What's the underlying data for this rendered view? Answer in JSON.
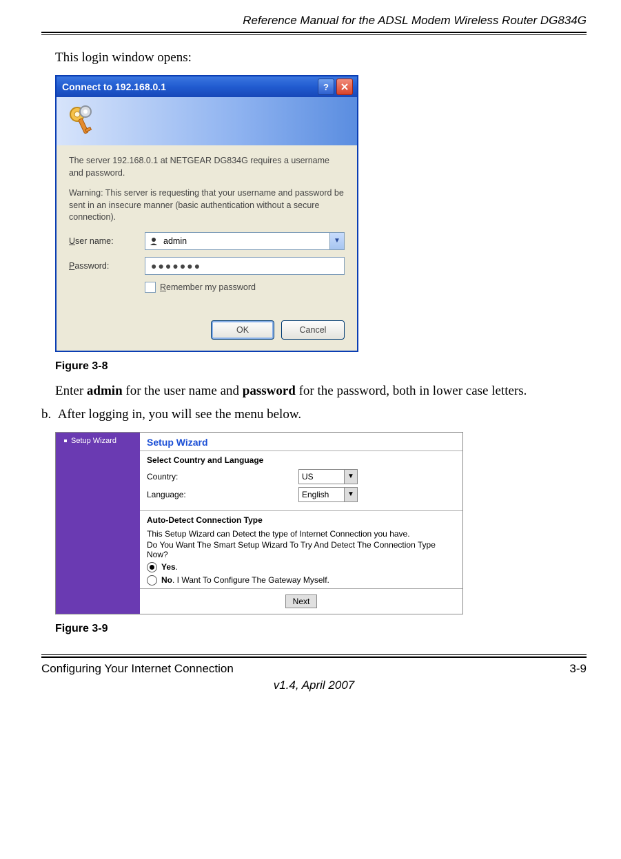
{
  "header": "Reference Manual for the ADSL Modem Wireless Router DG834G",
  "intro": "This login window opens:",
  "dialog": {
    "title": "Connect to 192.168.0.1",
    "msg1": "The server 192.168.0.1 at NETGEAR DG834G  requires a username and password.",
    "msg2": "Warning: This server is requesting that your username and password be sent in an insecure manner (basic authentication without a secure connection).",
    "user_label_u": "U",
    "user_label_rest": "ser name:",
    "user_value": "admin",
    "pass_label_u": "P",
    "pass_label_rest": "assword:",
    "pass_value": "●●●●●●●",
    "remember_u": "R",
    "remember_rest": "emember my password",
    "ok": "OK",
    "cancel": "Cancel"
  },
  "figure8": "Figure 3-8",
  "credentials": {
    "pre": "Enter ",
    "admin": "admin",
    "mid": " for the user name and ",
    "password": "password",
    "post": " for the password, both in lower case letters."
  },
  "step_b_marker": "b.",
  "step_b": "After logging in, you will see the menu below.",
  "wizard": {
    "side": "Setup Wizard",
    "title": "Setup Wizard",
    "section1_h": "Select Country and Language",
    "country_lbl": "Country:",
    "country_val": "US",
    "language_lbl": "Language:",
    "language_val": "English",
    "section2_h": "Auto-Detect Connection Type",
    "desc1": "This Setup Wizard can Detect the type of Internet Connection you have.",
    "desc2": "Do You Want The Smart Setup Wizard To Try And Detect The Connection Type Now?",
    "opt_yes_b": "Yes",
    "opt_yes_rest": ".",
    "opt_no_b": "No",
    "opt_no_rest": ". I Want To Configure The Gateway Myself.",
    "next": "Next"
  },
  "figure9": "Figure 3-9",
  "footer": {
    "left": "Configuring Your Internet Connection",
    "right": "3-9",
    "version": "v1.4, April 2007"
  }
}
